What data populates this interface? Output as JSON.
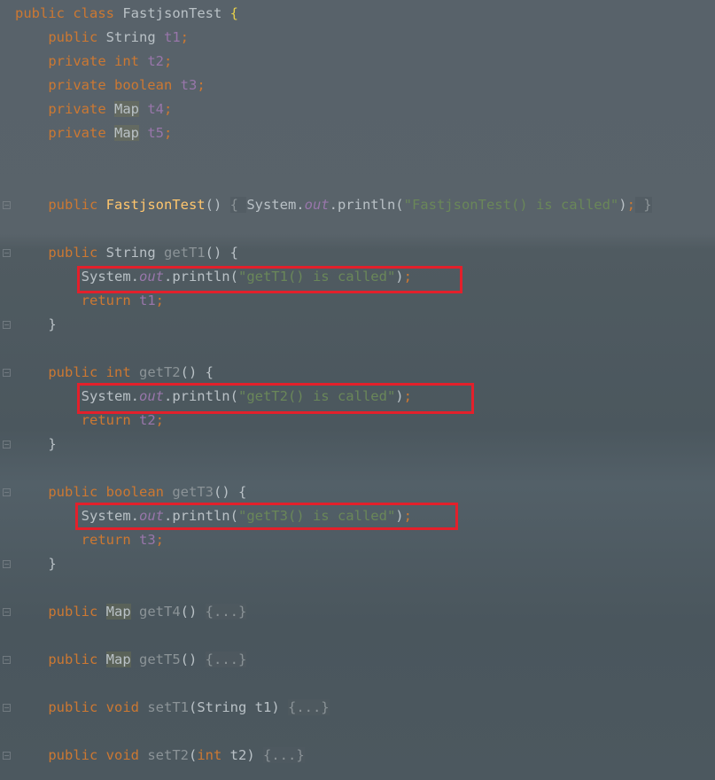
{
  "lines": [
    {
      "id": "l1",
      "parts": [
        [
          "kw",
          "public "
        ],
        [
          "kw",
          "class "
        ],
        [
          "typ",
          "FastjsonTest "
        ],
        [
          "brace-y",
          "{"
        ]
      ]
    },
    {
      "id": "l2",
      "parts": [
        [
          "kw",
          "    public "
        ],
        [
          "typ",
          "String "
        ],
        [
          "fld",
          "t1"
        ],
        [
          "kw",
          ";"
        ]
      ]
    },
    {
      "id": "l3",
      "parts": [
        [
          "kw",
          "    private "
        ],
        [
          "kw",
          "int "
        ],
        [
          "fld",
          "t2"
        ],
        [
          "kw",
          ";"
        ]
      ]
    },
    {
      "id": "l4",
      "parts": [
        [
          "kw",
          "    private "
        ],
        [
          "kw",
          "boolean "
        ],
        [
          "fld",
          "t3"
        ],
        [
          "kw",
          ";"
        ]
      ]
    },
    {
      "id": "l5",
      "parts": [
        [
          "kw",
          "    private "
        ],
        [
          "hl",
          "Map"
        ],
        [
          "typ",
          " "
        ],
        [
          "fld",
          "t4"
        ],
        [
          "kw",
          ";"
        ]
      ]
    },
    {
      "id": "l6",
      "parts": [
        [
          "kw",
          "    private "
        ],
        [
          "hl",
          "Map"
        ],
        [
          "typ",
          " "
        ],
        [
          "fld",
          "t5"
        ],
        [
          "kw",
          ";"
        ]
      ]
    },
    {
      "id": "l7",
      "parts": [
        [
          "typ",
          ""
        ]
      ]
    },
    {
      "id": "l8",
      "parts": [
        [
          "typ",
          ""
        ]
      ]
    },
    {
      "id": "l9",
      "parts": [
        [
          "kw",
          "    public "
        ],
        [
          "cls",
          "FastjsonTest"
        ],
        [
          "typ",
          "() "
        ],
        [
          "fold",
          "{ "
        ],
        [
          "typ",
          "System."
        ],
        [
          "out",
          "out"
        ],
        [
          "typ",
          ".println("
        ],
        [
          "str",
          "\"FastjsonTest() is called\""
        ],
        [
          "typ",
          ")"
        ],
        [
          "kw",
          ";"
        ],
        [
          "fold",
          " }"
        ]
      ]
    },
    {
      "id": "l10",
      "parts": [
        [
          "typ",
          ""
        ]
      ]
    },
    {
      "id": "l11",
      "parts": [
        [
          "kw",
          "    public "
        ],
        [
          "typ",
          "String "
        ],
        [
          "dim",
          "getT1"
        ],
        [
          "typ",
          "() {"
        ]
      ]
    },
    {
      "id": "l12",
      "parts": [
        [
          "typ",
          "        System."
        ],
        [
          "out",
          "out"
        ],
        [
          "typ",
          ".println("
        ],
        [
          "str",
          "\"getT1() is called\""
        ],
        [
          "typ",
          ")"
        ],
        [
          "kw",
          ";"
        ]
      ]
    },
    {
      "id": "l13",
      "parts": [
        [
          "kw",
          "        return "
        ],
        [
          "fld",
          "t1"
        ],
        [
          "kw",
          ";"
        ]
      ]
    },
    {
      "id": "l14",
      "parts": [
        [
          "typ",
          "    }"
        ]
      ]
    },
    {
      "id": "l15",
      "parts": [
        [
          "typ",
          ""
        ]
      ]
    },
    {
      "id": "l16",
      "parts": [
        [
          "kw",
          "    public "
        ],
        [
          "kw",
          "int "
        ],
        [
          "dim",
          "getT2"
        ],
        [
          "typ",
          "() {"
        ]
      ]
    },
    {
      "id": "l17",
      "parts": [
        [
          "typ",
          "        System."
        ],
        [
          "out",
          "out"
        ],
        [
          "typ",
          ".println("
        ],
        [
          "str",
          "\"getT2() is called\""
        ],
        [
          "typ",
          ")"
        ],
        [
          "kw",
          ";"
        ]
      ]
    },
    {
      "id": "l18",
      "parts": [
        [
          "kw",
          "        return "
        ],
        [
          "fld",
          "t2"
        ],
        [
          "kw",
          ";"
        ]
      ]
    },
    {
      "id": "l19",
      "parts": [
        [
          "typ",
          "    }"
        ]
      ]
    },
    {
      "id": "l20",
      "parts": [
        [
          "typ",
          ""
        ]
      ]
    },
    {
      "id": "l21",
      "parts": [
        [
          "kw",
          "    public "
        ],
        [
          "kw",
          "boolean "
        ],
        [
          "dim",
          "getT3"
        ],
        [
          "typ",
          "() {"
        ]
      ]
    },
    {
      "id": "l22",
      "parts": [
        [
          "typ",
          "        System."
        ],
        [
          "out",
          "out"
        ],
        [
          "typ",
          ".println("
        ],
        [
          "str",
          "\"getT3() is called\""
        ],
        [
          "typ",
          ")"
        ],
        [
          "kw",
          ";"
        ]
      ]
    },
    {
      "id": "l23",
      "parts": [
        [
          "kw",
          "        return "
        ],
        [
          "fld",
          "t3"
        ],
        [
          "kw",
          ";"
        ]
      ]
    },
    {
      "id": "l24",
      "parts": [
        [
          "typ",
          "    }"
        ]
      ]
    },
    {
      "id": "l25",
      "parts": [
        [
          "typ",
          ""
        ]
      ]
    },
    {
      "id": "l26",
      "parts": [
        [
          "kw",
          "    public "
        ],
        [
          "hl",
          "Map"
        ],
        [
          "typ",
          " "
        ],
        [
          "dim",
          "getT4"
        ],
        [
          "typ",
          "() "
        ],
        [
          "fold",
          "{...}"
        ]
      ]
    },
    {
      "id": "l27",
      "parts": [
        [
          "typ",
          ""
        ]
      ]
    },
    {
      "id": "l28",
      "parts": [
        [
          "kw",
          "    public "
        ],
        [
          "hl",
          "Map"
        ],
        [
          "typ",
          " "
        ],
        [
          "dim",
          "getT5"
        ],
        [
          "typ",
          "() "
        ],
        [
          "fold",
          "{...}"
        ]
      ]
    },
    {
      "id": "l29",
      "parts": [
        [
          "typ",
          ""
        ]
      ]
    },
    {
      "id": "l30",
      "parts": [
        [
          "kw",
          "    public "
        ],
        [
          "kw",
          "void "
        ],
        [
          "dim",
          "setT1"
        ],
        [
          "typ",
          "(String t1) "
        ],
        [
          "fold",
          "{...}"
        ]
      ]
    },
    {
      "id": "l31",
      "parts": [
        [
          "typ",
          ""
        ]
      ]
    },
    {
      "id": "l32",
      "parts": [
        [
          "kw",
          "    public "
        ],
        [
          "kw",
          "void "
        ],
        [
          "dim",
          "setT2"
        ],
        [
          "typ",
          "("
        ],
        [
          "kw",
          "int "
        ],
        [
          "typ",
          "t2) "
        ],
        [
          "fold",
          "{...}"
        ]
      ]
    }
  ],
  "highlight_color": "#e3202b",
  "icons": [
    "fold-marker-icon"
  ]
}
